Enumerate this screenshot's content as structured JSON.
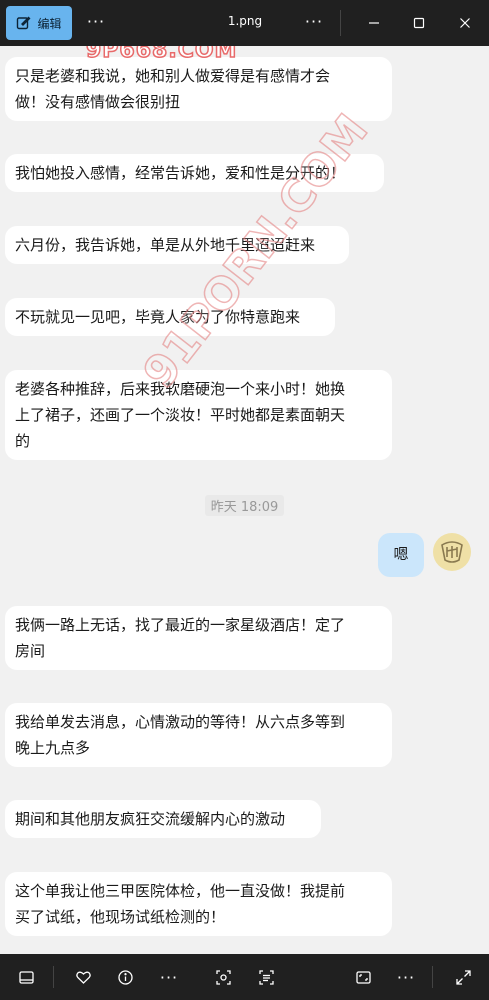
{
  "titlebar": {
    "edit_label": "编辑",
    "more_label": "···",
    "file_name": "1.png",
    "more2_label": "···"
  },
  "watermarks": {
    "top": "9P668.COM",
    "diagonal": "91PORN.COM"
  },
  "messages": [
    {
      "text_lines": [
        "只是老婆和我说，她和别人做爱得是有感情才会",
        "做！没有感情做会很别扭"
      ]
    },
    {
      "text_lines": [
        "我怕她投入感情，经常告诉她，爱和性是分开的！"
      ]
    },
    {
      "text_lines": [
        "六月份，我告诉她，单是从外地千里迢迢赶来"
      ]
    },
    {
      "text_lines": [
        "不玩就见一见吧，毕竟人家为了你特意跑来"
      ]
    },
    {
      "text_lines": [
        "老婆各种推辞，后来我软磨硬泡一个来小时！她换",
        "上了裙子，还画了一个淡妆！平时她都是素面朝天",
        "的"
      ]
    },
    {
      "text_lines": [
        "嗯"
      ]
    },
    {
      "text_lines": [
        "我俩一路上无话，找了最近的一家星级酒店！定了",
        "房间"
      ]
    },
    {
      "text_lines": [
        "我给单发去消息，心情激动的等待！从六点多等到",
        "晚上九点多"
      ]
    },
    {
      "text_lines": [
        "期间和其他朋友疯狂交流缓解内心的激动"
      ]
    },
    {
      "text_lines": [
        "这个单我让他三甲医院体检，他一直没做！我提前",
        "买了试纸，他现场试纸检测的！"
      ]
    }
  ],
  "timestamp": "昨天 18:09",
  "bottombar": {
    "more_label": "···",
    "more2_label": "···"
  }
}
